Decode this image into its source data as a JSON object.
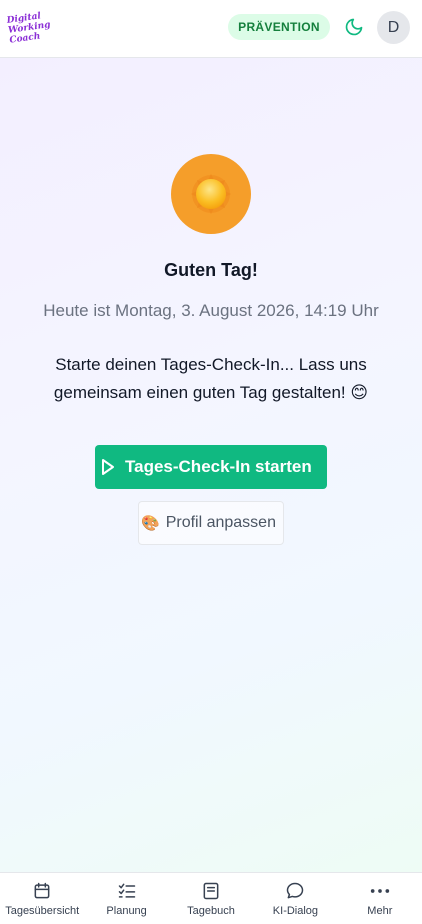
{
  "header": {
    "logo_lines": [
      "Digital",
      "Working",
      "Coach"
    ],
    "badge": "PRÄVENTION",
    "avatar_initial": "D"
  },
  "main": {
    "greeting": "Guten Tag!",
    "datetime": "Heute ist Montag, 3. August 2026, 14:19 Uhr",
    "intro_line1": "Starte deinen Tages-Check-In... Lass uns",
    "intro_line2": "gemeinsam einen guten Tag gestalten! 😊",
    "start_button": "Tages-Check-In starten",
    "profile_button": "Profil anpassen",
    "profile_icon": "🎨"
  },
  "bottom_nav": {
    "items": [
      {
        "label": "Tagesübersicht",
        "icon": "calendar-icon"
      },
      {
        "label": "Planung",
        "icon": "checklist-icon"
      },
      {
        "label": "Tagebuch",
        "icon": "book-icon"
      },
      {
        "label": "KI-Dialog",
        "icon": "chat-icon"
      },
      {
        "label": "Mehr",
        "icon": "more-icon"
      }
    ]
  },
  "colors": {
    "accent": "#10b981",
    "badge_bg": "#dcfce7",
    "badge_text": "#15803d",
    "sun_bg": "#f59e2a",
    "logo": "#8b2fd6"
  }
}
